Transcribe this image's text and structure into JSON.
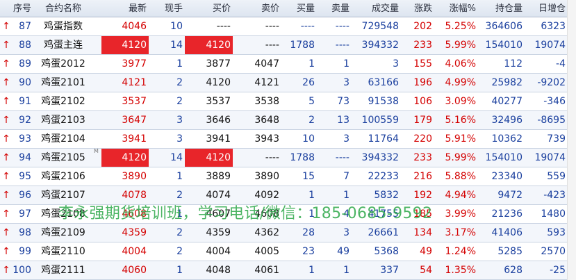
{
  "headers": {
    "idx": "序号",
    "name": "合约名称",
    "last": "最新",
    "vol": "现手",
    "bid": "买价",
    "ask": "卖价",
    "bidv": "买量",
    "askv": "卖量",
    "tvol": "成交量",
    "chg": "涨跌",
    "pct": "涨幅%",
    "oi": "持仓量",
    "oic": "日增仓"
  },
  "rows": [
    {
      "arrow": "↑",
      "idx": "87",
      "name": "鸡蛋指数",
      "last": "4046",
      "vol": "10",
      "bid": "----",
      "ask": "----",
      "bidv": "----",
      "askv": "----",
      "tvol": "729548",
      "chg": "202",
      "pct": "5.25%",
      "oi": "364606",
      "oic": "6323"
    },
    {
      "arrow": "↑",
      "idx": "88",
      "name": "鸡蛋主连",
      "last": "4120",
      "vol": "14",
      "bid": "4120",
      "ask": "----",
      "bidv": "1788",
      "askv": "----",
      "tvol": "394332",
      "chg": "233",
      "pct": "5.99%",
      "oi": "154010",
      "oic": "19074"
    },
    {
      "arrow": "↑",
      "idx": "89",
      "name": "鸡蛋2012",
      "last": "3977",
      "vol": "1",
      "bid": "3877",
      "ask": "4047",
      "bidv": "1",
      "askv": "1",
      "tvol": "3",
      "chg": "155",
      "pct": "4.06%",
      "oi": "112",
      "oic": "-4"
    },
    {
      "arrow": "↑",
      "idx": "90",
      "name": "鸡蛋2101",
      "last": "4121",
      "vol": "2",
      "bid": "4120",
      "ask": "4121",
      "bidv": "26",
      "askv": "3",
      "tvol": "63166",
      "chg": "196",
      "pct": "4.99%",
      "oi": "25982",
      "oic": "-9202"
    },
    {
      "arrow": "↑",
      "idx": "91",
      "name": "鸡蛋2102",
      "last": "3537",
      "vol": "2",
      "bid": "3537",
      "ask": "3538",
      "bidv": "5",
      "askv": "73",
      "tvol": "91538",
      "chg": "106",
      "pct": "3.09%",
      "oi": "40277",
      "oic": "-346"
    },
    {
      "arrow": "↑",
      "idx": "92",
      "name": "鸡蛋2103",
      "last": "3647",
      "vol": "3",
      "bid": "3646",
      "ask": "3648",
      "bidv": "2",
      "askv": "13",
      "tvol": "100559",
      "chg": "179",
      "pct": "5.16%",
      "oi": "32496",
      "oic": "-8695"
    },
    {
      "arrow": "↑",
      "idx": "93",
      "name": "鸡蛋2104",
      "last": "3941",
      "vol": "3",
      "bid": "3941",
      "ask": "3943",
      "bidv": "10",
      "askv": "3",
      "tvol": "11764",
      "chg": "220",
      "pct": "5.91%",
      "oi": "10362",
      "oic": "739"
    },
    {
      "arrow": "↑",
      "idx": "94",
      "name": "鸡蛋2105",
      "mark": "M",
      "last": "4120",
      "vol": "14",
      "bid": "4120",
      "ask": "----",
      "bidv": "1788",
      "askv": "----",
      "tvol": "394332",
      "chg": "233",
      "pct": "5.99%",
      "oi": "154010",
      "oic": "19074"
    },
    {
      "arrow": "↑",
      "idx": "95",
      "name": "鸡蛋2106",
      "last": "3890",
      "vol": "1",
      "bid": "3889",
      "ask": "3890",
      "bidv": "15",
      "askv": "7",
      "tvol": "22233",
      "chg": "216",
      "pct": "5.88%",
      "oi": "23340",
      "oic": "559"
    },
    {
      "arrow": "↑",
      "idx": "96",
      "name": "鸡蛋2107",
      "last": "4078",
      "vol": "2",
      "bid": "4074",
      "ask": "4092",
      "bidv": "1",
      "askv": "1",
      "tvol": "5832",
      "chg": "192",
      "pct": "4.94%",
      "oi": "9472",
      "oic": "-423"
    },
    {
      "arrow": "↑",
      "idx": "97",
      "name": "鸡蛋2108",
      "last": "4608",
      "vol": "1",
      "bid": "4607",
      "ask": "4608",
      "bidv": "1",
      "askv": "4",
      "tvol": "41755",
      "chg": "185",
      "pct": "3.99%",
      "oi": "21236",
      "oic": "1480"
    },
    {
      "arrow": "↑",
      "idx": "98",
      "name": "鸡蛋2109",
      "last": "4359",
      "vol": "2",
      "bid": "4359",
      "ask": "4362",
      "bidv": "28",
      "askv": "3",
      "tvol": "26661",
      "chg": "134",
      "pct": "3.17%",
      "oi": "41406",
      "oic": "593"
    },
    {
      "arrow": "↑",
      "idx": "99",
      "name": "鸡蛋2110",
      "last": "4004",
      "vol": "2",
      "bid": "4004",
      "ask": "4005",
      "bidv": "23",
      "askv": "49",
      "tvol": "5368",
      "chg": "49",
      "pct": "1.24%",
      "oi": "5285",
      "oic": "2570"
    },
    {
      "arrow": "↑",
      "idx": "100",
      "name": "鸡蛋2111",
      "last": "4060",
      "vol": "1",
      "bid": "4048",
      "ask": "4061",
      "bidv": "1",
      "askv": "1",
      "tvol": "337",
      "chg": "54",
      "pct": "1.35%",
      "oi": "628",
      "oic": "-25"
    }
  ],
  "watermark": "李永强期货培训班，学习电话/微信：185-0685-9592",
  "colors": {
    "up": "#d40000",
    "highlight": "#e8252a",
    "number_blue": "#1a3f9e",
    "watermark": "#2ea84a"
  }
}
